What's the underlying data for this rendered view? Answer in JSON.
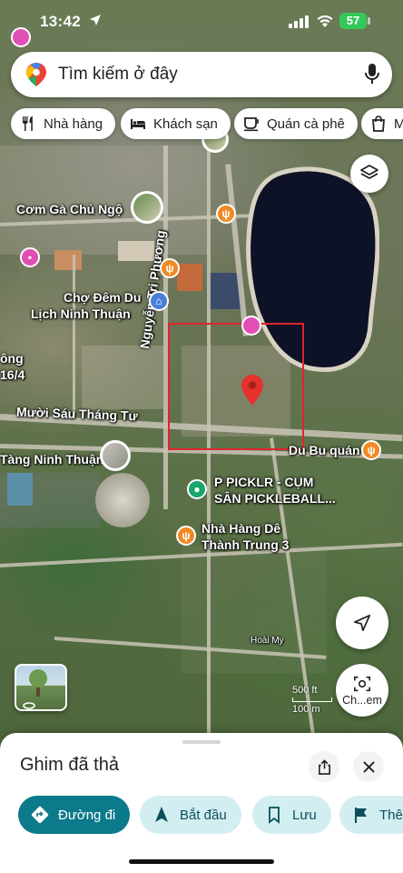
{
  "status_bar": {
    "time": "13:42",
    "battery": "57"
  },
  "search": {
    "placeholder": "Tìm kiếm ở đây"
  },
  "chips": [
    {
      "label": "Nhà hàng",
      "icon": "fork-knife-icon"
    },
    {
      "label": "Khách sạn",
      "icon": "bed-icon"
    },
    {
      "label": "Quán cà phê",
      "icon": "coffee-cup-icon"
    },
    {
      "label": "M",
      "icon": "shopping-bag-icon"
    }
  ],
  "map": {
    "labels": {
      "com_ga": "Cơm Gà Chủ Ngộ",
      "cho_dem_1": "Chợ Đêm Du",
      "cho_dem_2": "Lịch Ninh Thuận",
      "nguyen_tri_phuong": "Nguyễn Tri Phương",
      "ong": "ông",
      "sixteen_four": "16/4",
      "muoi_sau": "Mười Sáu Tháng Tư",
      "tang_ninh_thuan": "Tàng Ninh Thuận",
      "du_bu_quan": "Du Bu quán",
      "picklr_1": "P PICKLR - CỤM",
      "picklr_2": "SÂN PICKLEBALL...",
      "nha_hang_de_1": "Nhà Hàng Dê",
      "nha_hang_de_2": "Thành Trung 3",
      "hoai_my": "Hoài My"
    },
    "scale": {
      "top": "500 ft",
      "bottom": "100 m"
    }
  },
  "controls": {
    "lens_label": "Ch...em"
  },
  "sheet": {
    "title": "Ghim đã thả",
    "actions": [
      {
        "label": "Đường đi",
        "style": "primary",
        "icon": "directions-icon"
      },
      {
        "label": "Bắt đầu",
        "style": "secondary",
        "icon": "navigation-arrow-icon"
      },
      {
        "label": "Lưu",
        "style": "secondary",
        "icon": "bookmark-icon"
      },
      {
        "label": "Thê",
        "style": "secondary",
        "icon": "flag-icon"
      }
    ]
  },
  "colors": {
    "accent": "#0b7a8a",
    "accent_light": "#d3eef1",
    "highlight_rect": "#e0242c",
    "pin": "#e5322d"
  }
}
